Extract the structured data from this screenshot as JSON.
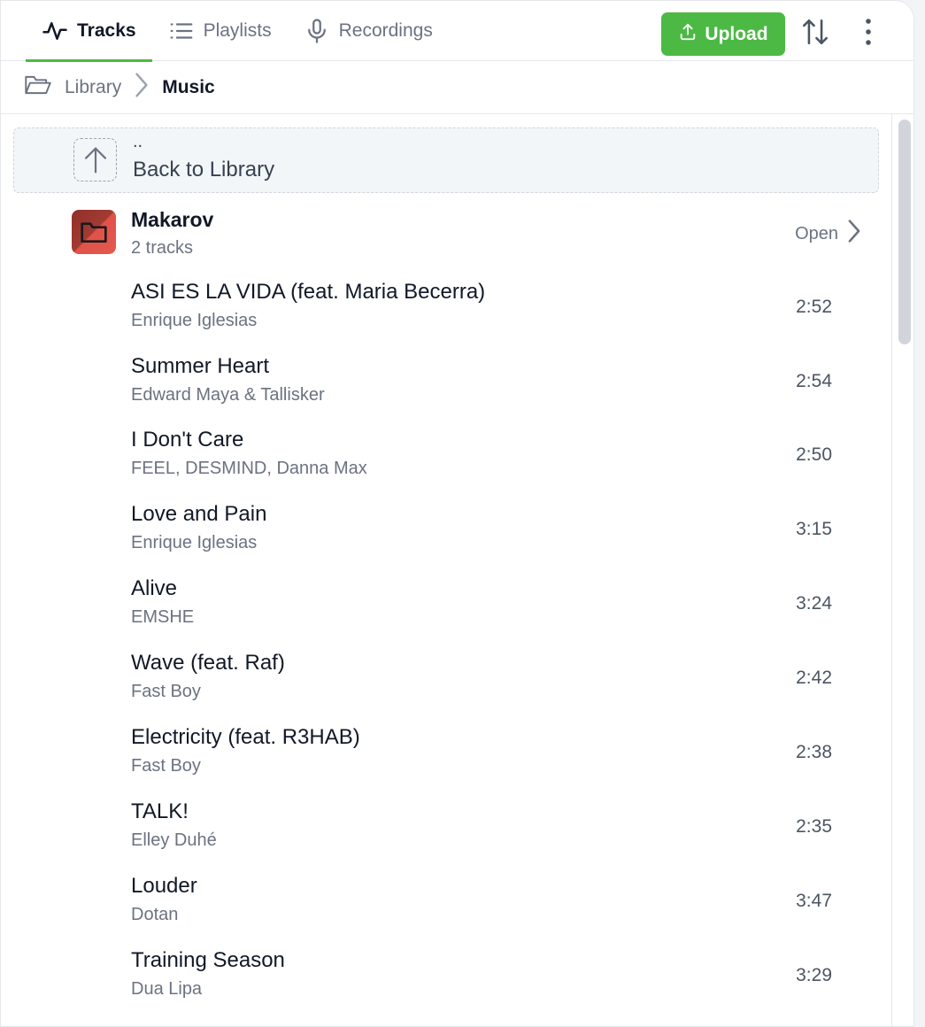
{
  "tabs": [
    {
      "label": "Tracks",
      "icon": "activity-icon",
      "active": true
    },
    {
      "label": "Playlists",
      "icon": "list-icon",
      "active": false
    },
    {
      "label": "Recordings",
      "icon": "microphone-icon",
      "active": false
    }
  ],
  "toolbar": {
    "upload_label": "Upload",
    "sort_icon": "sort-arrows-icon",
    "more_icon": "more-vertical-icon"
  },
  "breadcrumb": {
    "root": "Library",
    "current": "Music"
  },
  "back": {
    "dots": "..",
    "label": "Back to Library"
  },
  "album": {
    "title": "Makarov",
    "subtitle": "2 tracks",
    "open_label": "Open"
  },
  "tracks": [
    {
      "title": "ASI ES LA VIDA (feat. Maria Becerra)",
      "artist": "Enrique Iglesias",
      "duration": "2:52"
    },
    {
      "title": "Summer Heart",
      "artist": "Edward Maya & Tallisker",
      "duration": "2:54"
    },
    {
      "title": "I Don't Care",
      "artist": "FEEL, DESMIND, Danna Max",
      "duration": "2:50"
    },
    {
      "title": "Love and Pain",
      "artist": "Enrique Iglesias",
      "duration": "3:15"
    },
    {
      "title": "Alive",
      "artist": "EMSHE",
      "duration": "3:24"
    },
    {
      "title": "Wave (feat. Raf)",
      "artist": "Fast Boy",
      "duration": "2:42"
    },
    {
      "title": "Electricity (feat. R3HAB)",
      "artist": "Fast Boy",
      "duration": "2:38"
    },
    {
      "title": "TALK!",
      "artist": "Elley Duhé",
      "duration": "2:35"
    },
    {
      "title": "Louder",
      "artist": "Dotan",
      "duration": "3:47"
    },
    {
      "title": "Training Season",
      "artist": "Dua Lipa",
      "duration": "3:29"
    }
  ],
  "colors": {
    "accent": "#4cb944",
    "text": "#111827",
    "muted": "#6b7280"
  }
}
